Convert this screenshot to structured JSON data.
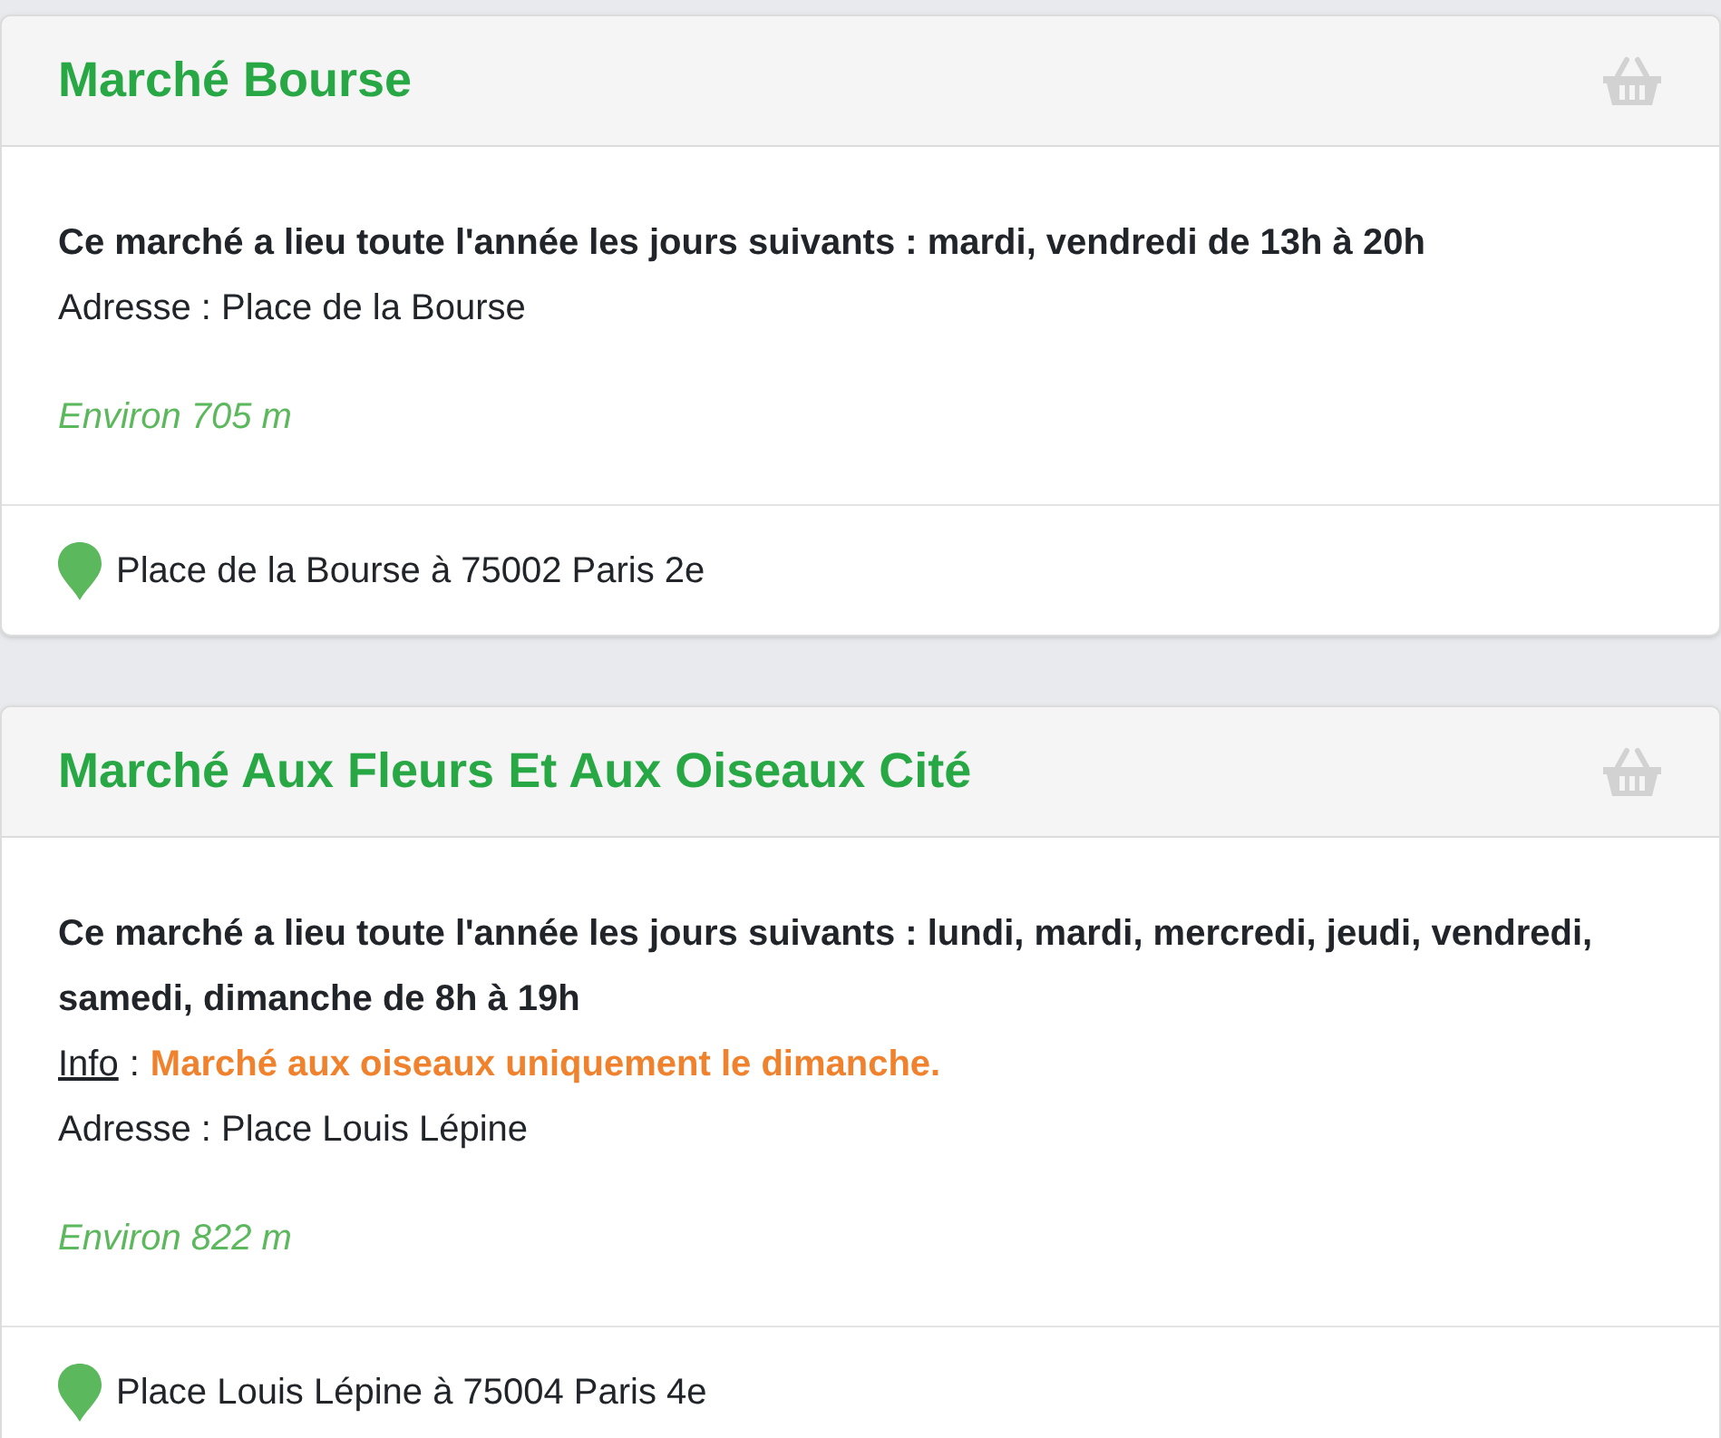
{
  "markets": [
    {
      "title": "Marché Bourse",
      "schedule": "Ce marché a lieu toute l'année les jours suivants : mardi, vendredi de 13h à 20h",
      "address": "Adresse : Place de la Bourse",
      "distance": "Environ 705 m",
      "location": "Place de la Bourse à 75002 Paris 2e"
    },
    {
      "title": "Marché Aux Fleurs Et Aux Oiseaux Cité",
      "schedule": "Ce marché a lieu toute l'année les jours suivants : lundi, mardi, mercredi, jeudi, vendredi, samedi, dimanche de 8h à 19h",
      "info": {
        "label": "Info",
        "separator": ":",
        "note": "Marché aux oiseaux uniquement le dimanche."
      },
      "address": "Adresse : Place Louis Lépine",
      "distance": "Environ 822 m",
      "location": "Place Louis Lépine à 75004 Paris 4e"
    }
  ]
}
